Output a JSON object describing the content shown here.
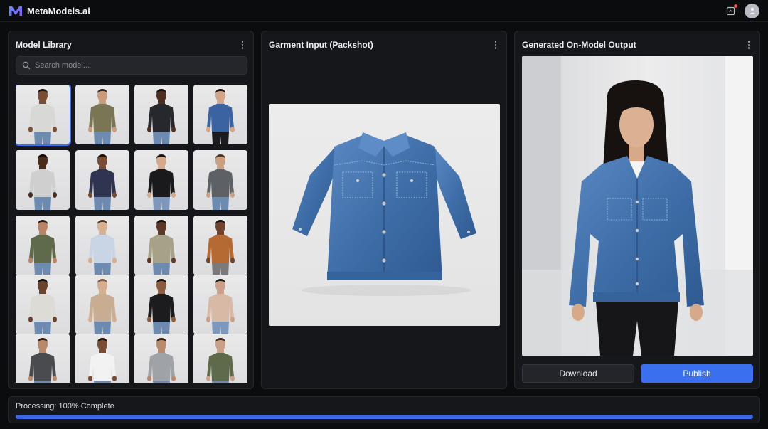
{
  "app": {
    "title": "MetaModels.ai",
    "brand_color": "#3d6df2"
  },
  "header": {
    "notification_icon": "notification-icon",
    "avatar_icon": "user-avatar-icon"
  },
  "library": {
    "title": "Model Library",
    "search_placeholder": "Search model...",
    "models": [
      {
        "name": "model-1",
        "shirt": "#d8d8d6",
        "skin": "#7a4e35",
        "pants": "#6d8bb0",
        "hair": "#1e1612",
        "selected": true
      },
      {
        "name": "model-2",
        "shirt": "#7a7655",
        "skin": "#c99a7c",
        "pants": "#6d8bb0",
        "hair": "#3a2a20"
      },
      {
        "name": "model-3",
        "shirt": "#26282d",
        "skin": "#4d2e1f",
        "pants": "#6d8bb0",
        "hair": "#141010"
      },
      {
        "name": "model-4",
        "shirt": "#3b63a1",
        "skin": "#d1a588",
        "pants": "#1c1c1e",
        "hair": "#1a1410"
      },
      {
        "name": "model-5",
        "shirt": "#cfcfd0",
        "skin": "#4a2c1d",
        "pants": "#6d8bb0",
        "hair": "#141010"
      },
      {
        "name": "model-6",
        "shirt": "#2f3450",
        "skin": "#7a4c33",
        "pants": "#6d8bb0",
        "hair": "#1a1410"
      },
      {
        "name": "model-7",
        "shirt": "#1a1a1c",
        "skin": "#d4a98c",
        "pants": "#7d97bd",
        "hair": "#1a1410"
      },
      {
        "name": "model-8",
        "shirt": "#5d6064",
        "skin": "#caa083",
        "pants": "#6d8bb0",
        "hair": "#4a3426"
      },
      {
        "name": "model-9",
        "shirt": "#5f6a4a",
        "skin": "#b78466",
        "pants": "#6d8bb0",
        "hair": "#2a1d16"
      },
      {
        "name": "model-10",
        "shirt": "#c9d4e4",
        "skin": "#d7b092",
        "pants": "#6d8bb0",
        "hair": "#4a3426"
      },
      {
        "name": "model-11",
        "shirt": "#a7a188",
        "skin": "#5c3828",
        "pants": "#6d8bb0",
        "hair": "#141010"
      },
      {
        "name": "model-12",
        "shirt": "#b46a32",
        "skin": "#6e4330",
        "pants": "#7a7a7c",
        "hair": "#1a1410"
      },
      {
        "name": "model-13",
        "shirt": "#dcdbd6",
        "skin": "#6a4330",
        "pants": "#6d8bb0",
        "hair": "#141010"
      },
      {
        "name": "model-14",
        "shirt": "#c9ad92",
        "skin": "#d6ad90",
        "pants": "#6d8bb0",
        "hair": "#7a5a3c"
      },
      {
        "name": "model-15",
        "shirt": "#1c1c1e",
        "skin": "#8c5c40",
        "pants": "#6d8bb0",
        "hair": "#141010"
      },
      {
        "name": "model-16",
        "shirt": "#d8b9a6",
        "skin": "#caa088",
        "pants": "#7d97bd",
        "hair": "#1a1410"
      },
      {
        "name": "model-17",
        "shirt": "#4a4b4e",
        "skin": "#b88a6c",
        "pants": "#6d8bb0",
        "hair": "#2a1d16"
      },
      {
        "name": "model-18",
        "shirt": "#f2f2f2",
        "skin": "#7a4c33",
        "pants": "#6d8bb0",
        "hair": "#1a1410"
      },
      {
        "name": "model-19",
        "shirt": "#9fa2a6",
        "skin": "#b98a6d",
        "pants": "#6d8bb0",
        "hair": "#2a1d16"
      },
      {
        "name": "model-20",
        "shirt": "#5f6a4a",
        "skin": "#caa088",
        "pants": "#6d8bb0",
        "hair": "#3a2a20"
      }
    ]
  },
  "garment": {
    "title": "Garment Input (Packshot)",
    "denim_color": "#4a78b3"
  },
  "output": {
    "title": "Generated On-Model Output",
    "download_label": "Download",
    "publish_label": "Publish"
  },
  "status": {
    "text": "Processing: 100% Complete",
    "progress": 1.0,
    "progress_color": "#3a66e8"
  }
}
